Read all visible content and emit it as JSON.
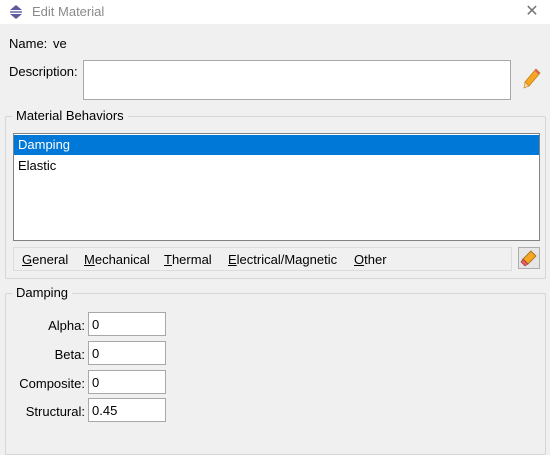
{
  "window": {
    "title": "Edit Material",
    "close_symbol": "✕"
  },
  "material": {
    "name_label": "Name:",
    "name_value": "ve",
    "description_label": "Description:",
    "description_value": ""
  },
  "behaviors": {
    "legend": "Material Behaviors",
    "items": [
      {
        "label": "Damping",
        "selected": true
      },
      {
        "label": "Elastic",
        "selected": false
      }
    ],
    "menu": [
      {
        "underline": "G",
        "rest": "eneral"
      },
      {
        "underline": "M",
        "rest": "echanical"
      },
      {
        "underline": "T",
        "rest": "hermal"
      },
      {
        "underline": "E",
        "rest": "lectrical/Magnetic"
      },
      {
        "underline": "O",
        "rest": "ther"
      }
    ]
  },
  "damping": {
    "legend": "Damping",
    "fields": [
      {
        "label": "Alpha:",
        "value": "0"
      },
      {
        "label": "Beta:",
        "value": "0"
      },
      {
        "label": "Composite:",
        "value": "0"
      },
      {
        "label": "Structural:",
        "value": "0.45"
      }
    ]
  },
  "colors": {
    "selection": "#0078d7",
    "background": "#f0f0f0"
  },
  "icons": [
    "app-icon",
    "close-icon",
    "pencil-icon",
    "eraser-icon"
  ]
}
